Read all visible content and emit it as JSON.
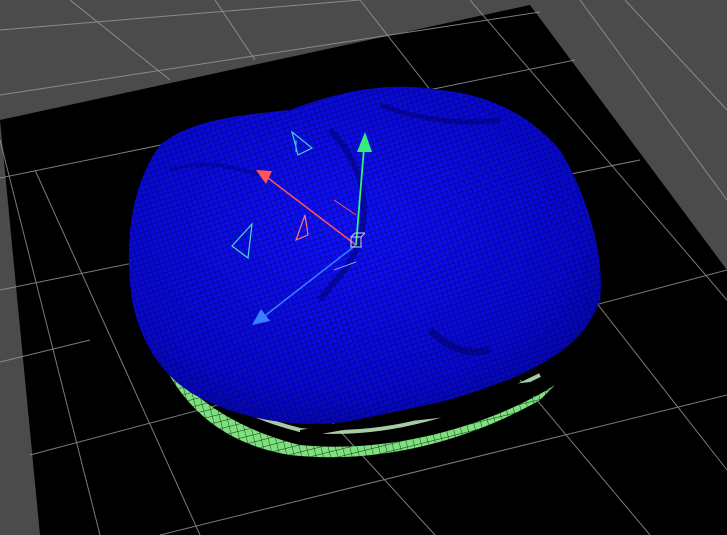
{
  "viewport": {
    "background_color": "#4b4b4b",
    "ground_plane_color": "#000000",
    "grid_line_color": "#9a9a9a",
    "mesh_fill_color": "#0a0ad8",
    "mesh_wire_color": "#000033",
    "mesh_underside_color": "#7ee07e"
  },
  "gizmo": {
    "x_axis_color": "#ff5555",
    "y_axis_color": "#33ee77",
    "z_axis_color": "#3a7fff",
    "center_icon": "pivot-cube-icon"
  }
}
